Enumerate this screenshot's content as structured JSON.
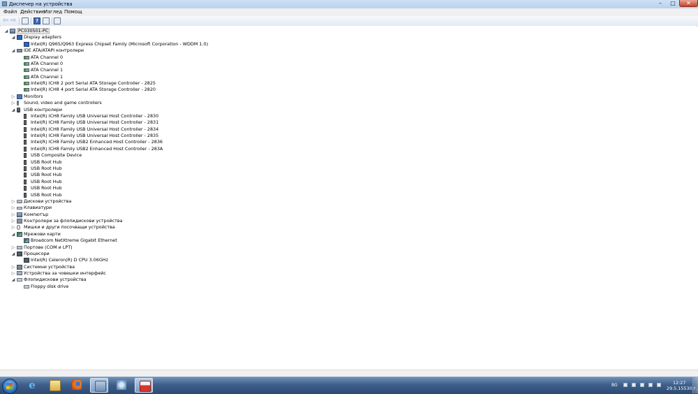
{
  "window": {
    "title": "Диспечер на устройства",
    "minimize_glyph": "–",
    "maximize_glyph": "□",
    "close_glyph": "✕"
  },
  "menu": [
    "Файл",
    "Действие",
    "Изглед",
    "Помощ"
  ],
  "toolbar": {
    "back_glyph": "⇦",
    "forward_glyph": "⇨",
    "help_glyph": "?"
  },
  "tree": {
    "root": "PC030501-PC",
    "expand_open": "◢",
    "expand_closed": "▷",
    "categories": [
      {
        "label": "Display adapters",
        "expanded": true,
        "icon": "display-adapter-icon",
        "children": [
          "Intel(R) Q965/Q963 Express Chipset Family (Microsoft Corporation - WDDM 1.0)"
        ]
      },
      {
        "label": "IDE ATA/ATAPI контролери",
        "expanded": true,
        "icon": "ide-controller-icon",
        "children": [
          "ATA Channel 0",
          "ATA Channel 0",
          "ATA Channel 1",
          "ATA Channel 1",
          "Intel(R) ICH8 2 port Serial ATA Storage Controller - 2825",
          "Intel(R) ICH8 4 port Serial ATA Storage Controller - 2820"
        ]
      },
      {
        "label": "Monitors",
        "expanded": false,
        "icon": "monitor-icon",
        "children": []
      },
      {
        "label": "Sound, video and game controllers",
        "expanded": false,
        "icon": "speaker-icon",
        "children": []
      },
      {
        "label": "USB контролери",
        "expanded": true,
        "icon": "usb-icon",
        "children": [
          "Intel(R) ICH8 Family USB Universal Host Controller - 2830",
          "Intel(R) ICH8 Family USB Universal Host Controller - 2831",
          "Intel(R) ICH8 Family USB Universal Host Controller - 2834",
          "Intel(R) ICH8 Family USB Universal Host Controller - 2835",
          "Intel(R) ICH8 Family USB2 Enhanced Host Controller - 2836",
          "Intel(R) ICH8 Family USB2 Enhanced Host Controller - 283A",
          "USB Composite Device",
          "USB Root Hub",
          "USB Root Hub",
          "USB Root Hub",
          "USB Root Hub",
          "USB Root Hub",
          "USB Root Hub"
        ]
      },
      {
        "label": "Дискови устройства",
        "expanded": false,
        "icon": "disk-drive-icon",
        "children": []
      },
      {
        "label": "Клавиатури",
        "expanded": false,
        "icon": "keyboard-icon",
        "children": []
      },
      {
        "label": "Компютър",
        "expanded": false,
        "icon": "computer-icon",
        "children": []
      },
      {
        "label": "Контролери за флопидискови устройства",
        "expanded": false,
        "icon": "floppy-controller-icon",
        "children": []
      },
      {
        "label": "Мишки и други посочващи устройства",
        "expanded": false,
        "icon": "mouse-icon",
        "children": []
      },
      {
        "label": "Мрежови карти",
        "expanded": true,
        "icon": "network-adapter-icon",
        "children": [
          "Broadcom NetXtreme Gigabit Ethernet"
        ]
      },
      {
        "label": "Портове (COM и LPT)",
        "expanded": false,
        "icon": "port-icon",
        "children": []
      },
      {
        "label": "Процесори",
        "expanded": true,
        "icon": "processor-icon",
        "children": [
          "Intel(R) Celeron(R) D CPU 3.06GHz"
        ]
      },
      {
        "label": "Системни устройства",
        "expanded": false,
        "icon": "system-device-icon",
        "children": []
      },
      {
        "label": "Устройства за човешки интерфейс",
        "expanded": false,
        "icon": "hid-icon",
        "children": []
      },
      {
        "label": "Флопидискови устройства",
        "expanded": true,
        "icon": "floppy-drive-icon",
        "children": [
          "Floppy disk drive"
        ]
      }
    ]
  },
  "taskbar": {
    "ie_glyph": "e",
    "language": "BG",
    "time": "12:27",
    "date": "29.5.15530 г."
  }
}
